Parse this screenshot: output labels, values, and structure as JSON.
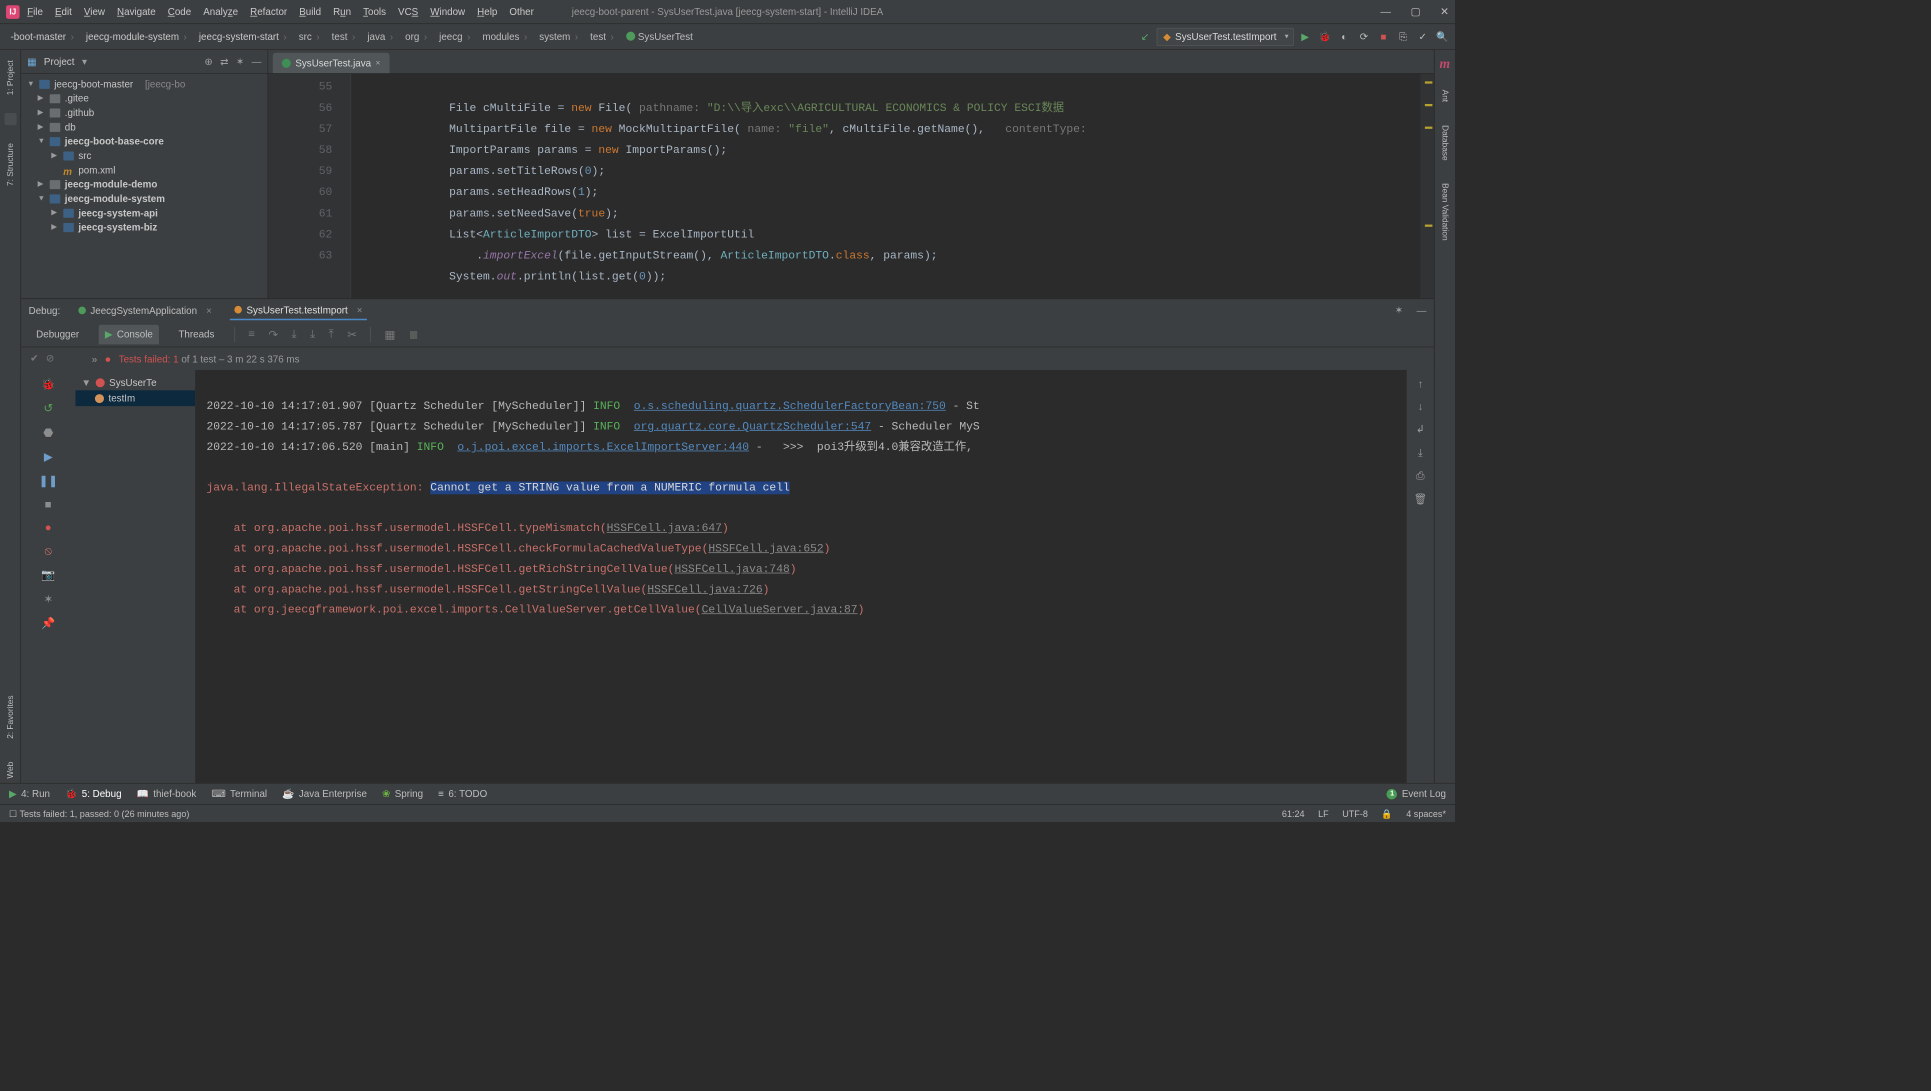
{
  "menu": [
    "File",
    "Edit",
    "View",
    "Navigate",
    "Code",
    "Analyze",
    "Refactor",
    "Build",
    "Run",
    "Tools",
    "VCS",
    "Window",
    "Help",
    "Other"
  ],
  "window_title": "jeecg-boot-parent - SysUserTest.java [jeecg-system-start] - IntelliJ IDEA",
  "breadcrumbs": [
    "-boot-master",
    "jeecg-module-system",
    "jeecg-system-start",
    "src",
    "test",
    "java",
    "org",
    "jeecg",
    "modules",
    "system",
    "test",
    "SysUserTest"
  ],
  "run_config": "SysUserTest.testImport",
  "left_tabs": {
    "project": "1: Project",
    "structure": "7: Structure",
    "favorites": "2: Favorites",
    "web": "Web"
  },
  "right_tabs": {
    "maven": "m",
    "ant": "Ant",
    "database": "Database",
    "bean": "Bean Validation"
  },
  "project": {
    "title": "Project",
    "root": "jeecg-boot-master",
    "root_suffix": "[jeecg-bo",
    "nodes": [
      {
        "i": 1,
        "chev": "▶",
        "name": ".gitee"
      },
      {
        "i": 1,
        "chev": "▶",
        "name": ".github"
      },
      {
        "i": 1,
        "chev": "▶",
        "name": "db"
      },
      {
        "i": 1,
        "chev": "▼",
        "name": "jeecg-boot-base-core",
        "bold": true,
        "src": true
      },
      {
        "i": 2,
        "chev": "▶",
        "name": "src",
        "src": true
      },
      {
        "i": 2,
        "chev": "",
        "name": "pom.xml",
        "mav": true
      },
      {
        "i": 1,
        "chev": "▶",
        "name": "jeecg-module-demo",
        "bold": true
      },
      {
        "i": 1,
        "chev": "▼",
        "name": "jeecg-module-system",
        "bold": true,
        "src": true
      },
      {
        "i": 2,
        "chev": "▶",
        "name": "jeecg-system-api",
        "bold": true,
        "src": true
      },
      {
        "i": 2,
        "chev": "▶",
        "name": "jeecg-system-biz",
        "bold": true,
        "src": true
      }
    ]
  },
  "editor": {
    "tab": "SysUserTest.java",
    "lines": [
      55,
      56,
      57,
      58,
      59,
      60,
      61,
      62,
      63
    ],
    "lineCount": 9
  },
  "code_tokens": {
    "l55_a": "File cMultiFile = ",
    "l55_new": "new",
    "l55_b": " File( ",
    "l55_hint": "pathname:",
    "l55_str": " \"D:\\\\导入exc\\\\AGRICULTURAL ECONOMICS & POLICY ESCI数据",
    "l56_a": "MultipartFile file = ",
    "l56_new": "new",
    "l56_b": " MockMultipartFile( ",
    "l56_hint": "name:",
    "l56_str": " \"file\"",
    "l56_c": ", cMultiFile.getName(),   ",
    "l56_hint2": "contentType:",
    "l57_a": "ImportParams params = ",
    "l57_new": "new",
    "l57_b": " ImportParams();",
    "l58_a": "params.setTitleRows(",
    "l58_n": "0",
    "l58_b": ");",
    "l59_a": "params.setHeadRows(",
    "l59_n": "1",
    "l59_b": ");",
    "l60_a": "params.setNeedSave(",
    "l60_n": "true",
    "l60_b": ");",
    "l61_a": "List<",
    "l61_cls": "ArticleImportDTO",
    "l61_b": "> list = ExcelImportUtil",
    "l62_a": "    .",
    "l62_m": "importExcel",
    "l62_b": "(file.getInputStream(), ",
    "l62_cls": "ArticleImportDTO",
    "l62_c": ".",
    "l62_kw": "class",
    "l62_d": ", params);",
    "l63_a": "System.",
    "l63_f": "out",
    "l63_b": ".println(list.get(",
    "l63_n": "0",
    "l63_c": "));"
  },
  "debug": {
    "label": "Debug:",
    "tabs": [
      {
        "name": "JeecgSystemApplication",
        "active": false
      },
      {
        "name": "SysUserTest.testImport",
        "active": true
      }
    ],
    "sub": {
      "debugger": "Debugger",
      "console": "Console",
      "threads": "Threads"
    },
    "status_prefix": "Tests failed: 1",
    "status_suffix": " of 1 test – 3 m 22 s 376 ms",
    "chevrons": "»",
    "tree_root": "SysUserTe",
    "tree_child": "testIm"
  },
  "console": {
    "r1_t": "2022-10-10 14:17:01.907 [Quartz Scheduler [MyScheduler]] ",
    "r1_lvl": "INFO",
    "r1_link": "o.s.scheduling.quartz.SchedulerFactoryBean:750",
    "r1_s": " - St",
    "r2_t": "2022-10-10 14:17:05.787 [Quartz Scheduler [MyScheduler]] ",
    "r2_lvl": "INFO",
    "r2_link": "org.quartz.core.QuartzScheduler:547",
    "r2_s": " - Scheduler MyS",
    "r3_t": "2022-10-10 14:17:06.520 [main] ",
    "r3_lvl": "INFO",
    "r3_link": "o.j.poi.excel.imports.ExcelImportServer:440",
    "r3_s": " -   >>>  poi3升级到4.0兼容改造工作,",
    "ex_a": "java.lang.IllegalStateException: ",
    "ex_b": "Cannot get a STRING value from a NUMERIC formula cell",
    "st1_a": "    at org.apache.poi.hssf.usermodel.HSSFCell.typeMismatch(",
    "st1_l": "HSSFCell.java:647",
    "st1_b": ")",
    "st2_a": "    at org.apache.poi.hssf.usermodel.HSSFCell.checkFormulaCachedValueType(",
    "st2_l": "HSSFCell.java:652",
    "st2_b": ")",
    "st3_a": "    at org.apache.poi.hssf.usermodel.HSSFCell.getRichStringCellValue(",
    "st3_l": "HSSFCell.java:748",
    "st3_b": ")",
    "st4_a": "    at org.apache.poi.hssf.usermodel.HSSFCell.getStringCellValue(",
    "st4_l": "HSSFCell.java:726",
    "st4_b": ")",
    "st5_a": "    at org.jeecgframework.poi.excel.imports.CellValueServer.getCellValue(",
    "st5_l": "CellValueServer.java:87",
    "st5_b": ")"
  },
  "bottom": {
    "run": "4: Run",
    "debug": "5: Debug",
    "thief": "thief-book",
    "terminal": "Terminal",
    "javaee": "Java Enterprise",
    "spring": "Spring",
    "todo": "6: TODO",
    "eventlog": "Event Log"
  },
  "status": {
    "msg": "Tests failed: 1, passed: 0 (26 minutes ago)",
    "pos": "61:24",
    "lf": "LF",
    "enc": "UTF-8",
    "indent": "4 spaces*"
  }
}
